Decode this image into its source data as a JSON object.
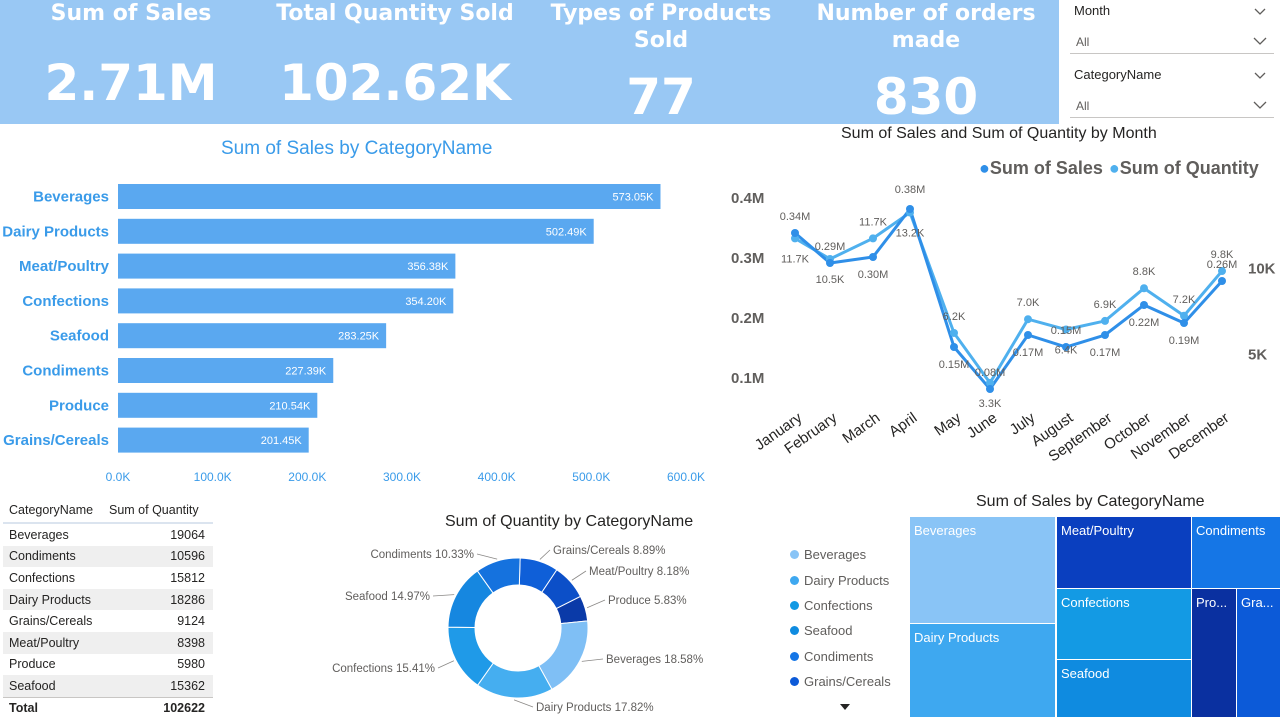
{
  "kpis": [
    {
      "title": "Sum of Sales",
      "value": "2.71M"
    },
    {
      "title": "Total Quantity Sold",
      "value": "102.62K"
    },
    {
      "title": "Types of Products Sold",
      "value": "77"
    },
    {
      "title": "Number of orders made",
      "value": "830"
    }
  ],
  "slicers": [
    {
      "label": "Month",
      "value": "All"
    },
    {
      "label": "CategoryName",
      "value": "All"
    }
  ],
  "colors": {
    "kpi_band": "#99c8f4",
    "bar": "#5aa8f0",
    "bar_label": "#2f8fe8",
    "line_sales": "#2f8fe8",
    "line_qty": "#4fb0ee"
  },
  "bar_chart": {
    "title": "Sum of Sales by CategoryName",
    "chart_data": {
      "type": "bar",
      "orientation": "horizontal",
      "categories": [
        "Beverages",
        "Dairy Products",
        "Meat/Poultry",
        "Confections",
        "Seafood",
        "Condiments",
        "Produce",
        "Grains/Cereals"
      ],
      "values": [
        573.05,
        502.49,
        356.38,
        354.2,
        283.25,
        227.39,
        210.54,
        201.45
      ],
      "value_labels": [
        "573.05K",
        "502.49K",
        "356.38K",
        "354.20K",
        "283.25K",
        "227.39K",
        "210.54K",
        "201.45K"
      ],
      "xlim": [
        0,
        600
      ],
      "xticks": [
        "0.0K",
        "100.0K",
        "200.0K",
        "300.0K",
        "400.0K",
        "500.0K",
        "600.0K"
      ],
      "grid": false
    }
  },
  "line_chart": {
    "title": "Sum of Sales and Sum of Quantity by Month",
    "legend": [
      "Sum of Sales",
      "Sum of Quantity"
    ],
    "chart_data": {
      "type": "line",
      "categories": [
        "January",
        "February",
        "March",
        "April",
        "May",
        "June",
        "July",
        "August",
        "September",
        "October",
        "November",
        "December"
      ],
      "series": [
        {
          "name": "Sum of Sales",
          "axis": "left",
          "values": [
            0.34,
            0.29,
            0.3,
            0.38,
            0.15,
            0.08,
            0.17,
            0.15,
            0.17,
            0.22,
            0.19,
            0.26
          ],
          "labels": [
            "0.34M",
            "0.29M",
            "0.30M",
            "0.38M",
            "0.15M",
            "0.08M",
            "0.17M",
            "0.15M",
            "0.17M",
            "0.22M",
            "0.19M",
            "0.26M"
          ]
        },
        {
          "name": "Sum of Quantity",
          "axis": "right",
          "values": [
            11.7,
            10.5,
            11.7,
            13.2,
            6.2,
            3.3,
            7.0,
            6.4,
            6.9,
            8.8,
            7.2,
            9.8
          ],
          "labels": [
            "11.7K",
            "10.5K",
            "11.7K",
            "13.2K",
            "6.2K",
            "3.3K",
            "7.0K",
            "6.4K",
            "6.9K",
            "8.8K",
            "7.2K",
            "9.8K"
          ]
        }
      ],
      "left_ticks": [
        {
          "label": "0.4M",
          "value": 0.4
        },
        {
          "label": "0.3M",
          "value": 0.3
        },
        {
          "label": "0.2M",
          "value": 0.2
        },
        {
          "label": "0.1M",
          "value": 0.1
        }
      ],
      "right_ticks": [
        {
          "label": "10K",
          "value": 10
        },
        {
          "label": "5K",
          "value": 5
        }
      ]
    }
  },
  "quantity_table": {
    "headers": [
      "CategoryName",
      "Sum of Quantity"
    ],
    "rows": [
      [
        "Beverages",
        "19064"
      ],
      [
        "Condiments",
        "10596"
      ],
      [
        "Confections",
        "15812"
      ],
      [
        "Dairy Products",
        "18286"
      ],
      [
        "Grains/Cereals",
        "9124"
      ],
      [
        "Meat/Poultry",
        "8398"
      ],
      [
        "Produce",
        "5980"
      ],
      [
        "Seafood",
        "15362"
      ]
    ],
    "total_label": "Total",
    "total_value": "102622"
  },
  "donut_chart": {
    "title": "Sum of Quantity by CategoryName",
    "chart_data": {
      "type": "pie",
      "donut": true,
      "slices": [
        {
          "label": "Beverages",
          "percent": 18.58,
          "text": "Beverages 18.58%",
          "color": "#7fbff5"
        },
        {
          "label": "Dairy Products",
          "percent": 17.82,
          "text": "Dairy Products 17.82%",
          "color": "#45aef0"
        },
        {
          "label": "Confections",
          "percent": 15.41,
          "text": "Confections 15.41%",
          "color": "#1f9ae8"
        },
        {
          "label": "Seafood",
          "percent": 14.97,
          "text": "Seafood 14.97%",
          "color": "#1687e0"
        },
        {
          "label": "Condiments",
          "percent": 10.33,
          "text": "Condiments 10.33%",
          "color": "#1572de"
        },
        {
          "label": "Grains/Cereals",
          "percent": 8.89,
          "text": "Grains/Cereals 8.89%",
          "color": "#0f5fd8"
        },
        {
          "label": "Meat/Poultry",
          "percent": 8.18,
          "text": "Meat/Poultry 8.18%",
          "color": "#0c4fc8"
        },
        {
          "label": "Produce",
          "percent": 5.83,
          "text": "Produce 5.83%",
          "color": "#0a3aa8"
        }
      ]
    }
  },
  "treemap_legend": [
    "Beverages",
    "Dairy Products",
    "Confections",
    "Seafood",
    "Condiments",
    "Grains/Cereals"
  ],
  "treemap": {
    "title": "Sum of Sales by CategoryName",
    "tiles": [
      {
        "label": "Beverages",
        "color": "#89c4f6"
      },
      {
        "label": "Dairy Products",
        "color": "#3ea8f0"
      },
      {
        "label": "Meat/Poultry",
        "color": "#0a3fbf"
      },
      {
        "label": "Confections",
        "color": "#139ae4"
      },
      {
        "label": "Seafood",
        "color": "#0f8be0"
      },
      {
        "label": "Condiments",
        "color": "#1576e6"
      },
      {
        "label": "Pro...",
        "color": "#0a30a0"
      },
      {
        "label": "Gra...",
        "color": "#0c5ad8"
      }
    ]
  }
}
